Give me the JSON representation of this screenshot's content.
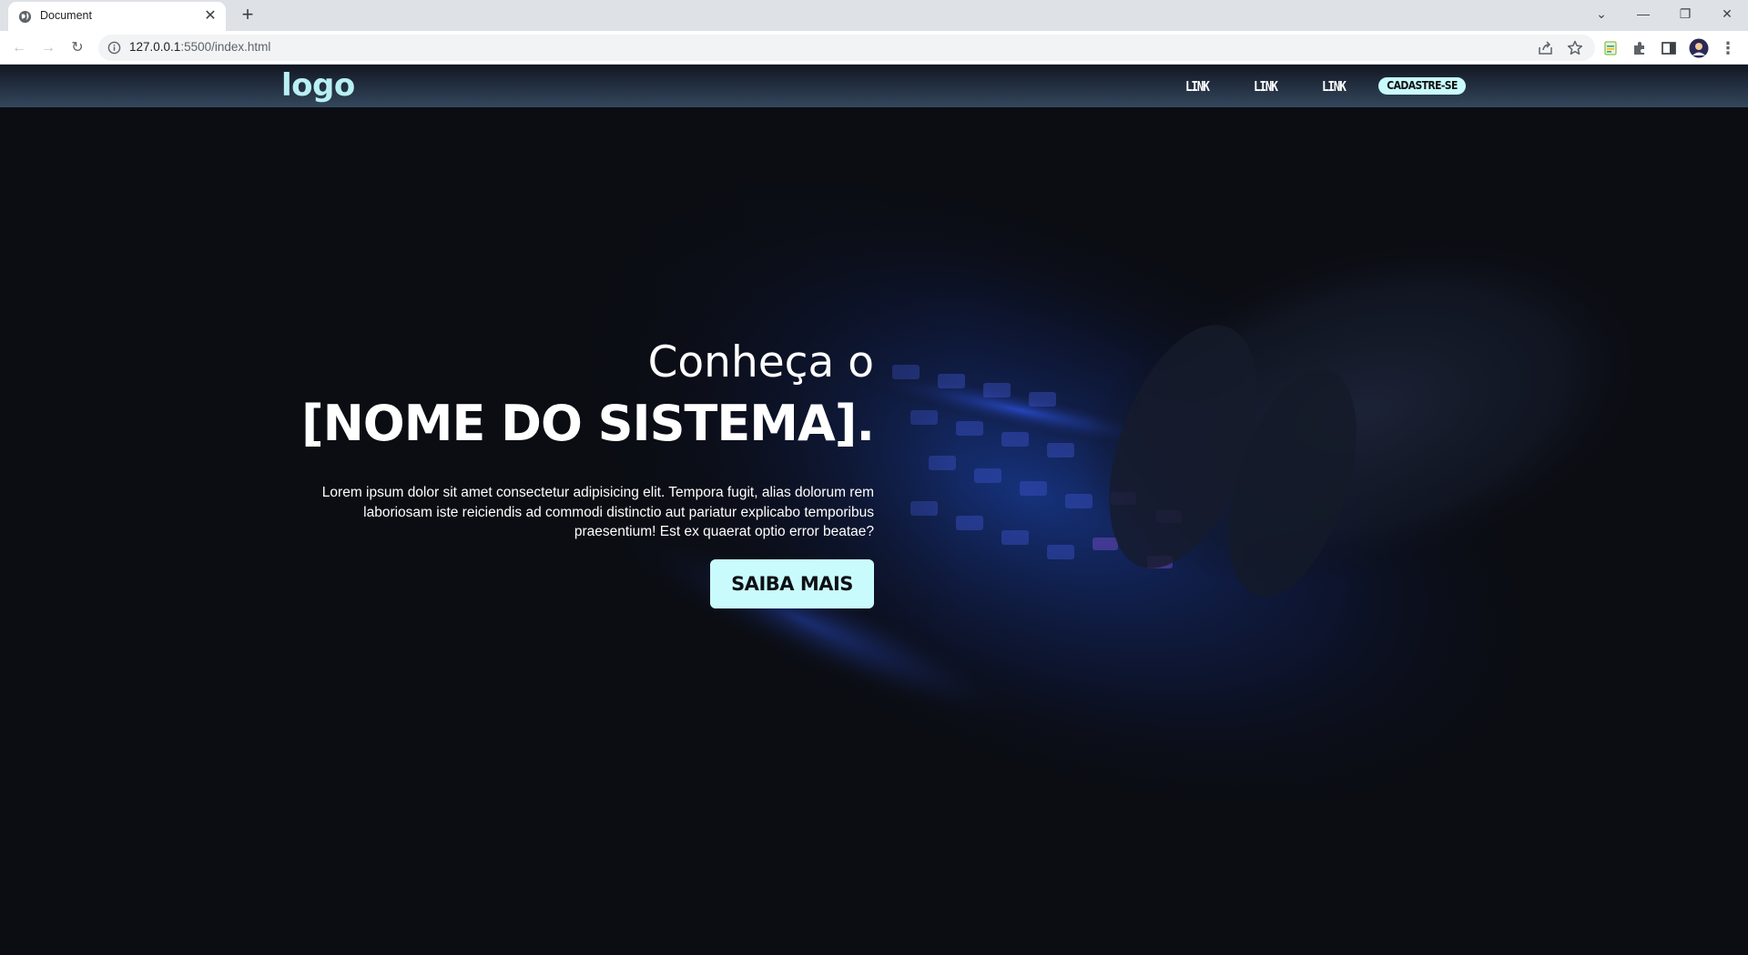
{
  "browser": {
    "tab_title": "Document",
    "tab_close": "✕",
    "new_tab": "+",
    "url_host": "127.0.0.1",
    "url_path": ":5500/index.html",
    "window_controls": {
      "list": "⌄",
      "minimize": "—",
      "restore": "❐",
      "close": "✕"
    },
    "nav": {
      "back": "←",
      "forward": "→",
      "reload": "↻"
    }
  },
  "site": {
    "logo": "logo",
    "nav_links": [
      "LINK",
      "LINK",
      "LINK"
    ],
    "signup_label": "CADASTRE-SE",
    "accent_color": "#c9fbfc",
    "logo_color": "#b9f0f4"
  },
  "hero": {
    "subtitle": "Conheça o",
    "title": "[NOME DO SISTEMA].",
    "text_lines": [
      "Lorem ipsum dolor sit amet consectetur adipisicing elit. Tempora fugit, alias dolorum rem",
      "laboriosam iste reiciendis ad commodi distinctio aut pariatur explicabo temporibus",
      "praesentium! Est ex quaerat optio error beatae?"
    ],
    "cta_label": "SAIBA MAIS"
  }
}
